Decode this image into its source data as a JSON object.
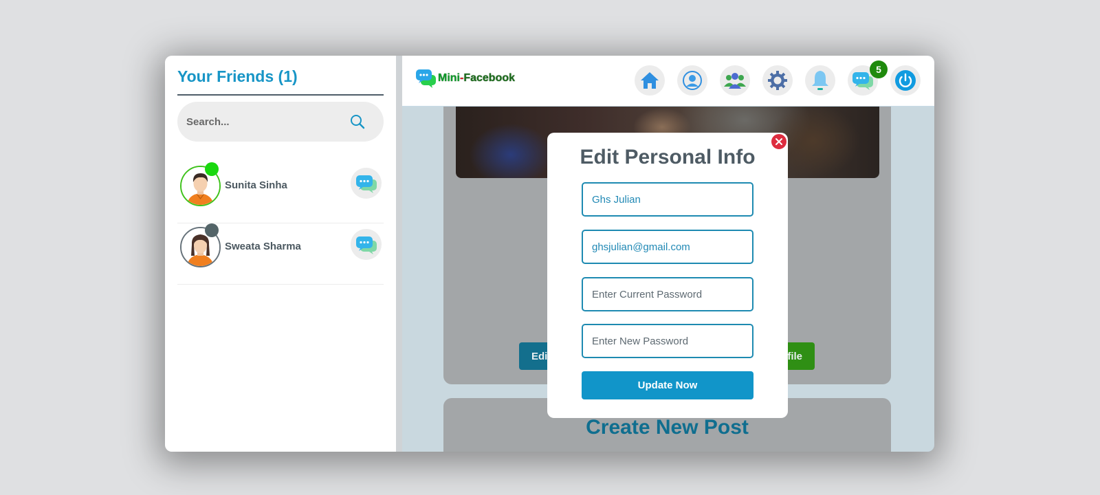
{
  "sidebar": {
    "title": "Your Friends (1)",
    "search_placeholder": "Search...",
    "friends": [
      {
        "name": "Sunita Sinha",
        "status": "online"
      },
      {
        "name": "Sweata Sharma",
        "status": "offline"
      }
    ]
  },
  "header": {
    "logo_first": "Mini",
    "logo_dash": "-",
    "logo_rest": "Facebook",
    "nav": [
      "home-icon",
      "profile-icon",
      "friends-icon",
      "settings-icon",
      "notifications-icon",
      "messages-icon",
      "logout-icon"
    ],
    "messages_badge": "5"
  },
  "background": {
    "edit_button_label": "Edi",
    "profile_button_label": "ofile",
    "create_post_title": "Create New Post"
  },
  "modal": {
    "title": "Edit Personal Info",
    "name_value": "Ghs Julian",
    "email_value": "ghsjulian@gmail.com",
    "current_password_placeholder": "Enter Current Password",
    "new_password_placeholder": "Enter New Password",
    "submit_label": "Update Now"
  },
  "colors": {
    "accent": "#1795c6",
    "online": "#19d80f",
    "offline": "#536468",
    "badge": "#1f8a0d",
    "close": "#dd2d3f"
  }
}
